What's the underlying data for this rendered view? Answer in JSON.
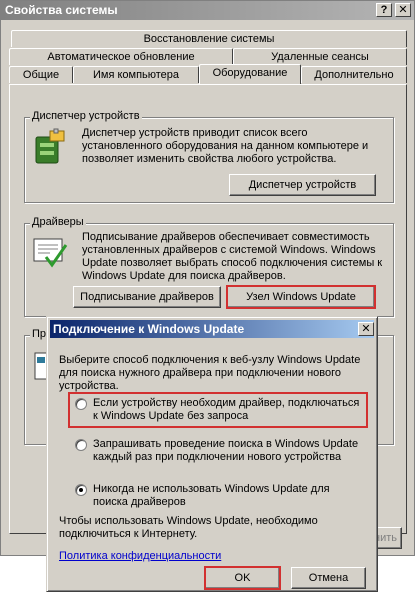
{
  "window": {
    "title": "Свойства системы",
    "help_glyph": "?",
    "close_glyph": "✕",
    "tabs_back": [
      "Восстановление системы"
    ],
    "tabs_middle": [
      "Автоматическое обновление",
      "Удаленные сеансы"
    ],
    "tabs_front": [
      "Общие",
      "Имя компьютера",
      "Оборудование",
      "Дополнительно"
    ],
    "active_tab": "Оборудование"
  },
  "device_manager": {
    "group_title": "Диспетчер устройств",
    "description": "Диспетчер устройств приводит список всего установленного оборудования на данном компьютере и позволяет изменить свойства любого устройства.",
    "button": "Диспетчер устройств"
  },
  "drivers": {
    "group_title": "Драйверы",
    "description": "Подписывание драйверов обеспечивает совместимость установленных драйверов с системой Windows.  Windows Update позволяет выбрать способ подключения системы к Windows Update для поиска драйверов.",
    "signing_button": "Подписывание драйверов",
    "windows_update_button": "Узел Windows Update"
  },
  "hidden_fragments": {
    "group_label_fragment": "Пр",
    "button_fragment": "нить"
  },
  "dialog": {
    "title": "Подключение к Windows Update",
    "close_glyph": "✕",
    "intro": "Выберите способ подключения к веб-узлу Windows Update для поиска нужного драйвера при подключении нового устройства.",
    "options": [
      {
        "label": "Если устройству необходим драйвер, подключаться к Windows Update без запроса",
        "selected": false
      },
      {
        "label": "Запрашивать проведение поиска в Windows Update каждый раз при подключении нового устройства",
        "selected": false
      },
      {
        "label": "Никогда не использовать Windows Update для поиска драйверов",
        "selected": true
      }
    ],
    "footer_note": "Чтобы использовать Windows Update, необходимо подключиться к Интернету.",
    "privacy_link": "Политика конфиденциальности",
    "ok_button": "OK",
    "cancel_button": "Отмена"
  },
  "colors": {
    "dialog_title_start": "#0a246a",
    "dialog_title_end": "#a6caf0",
    "inactive_title": "#808080",
    "highlight_outline": "#d23030",
    "face": "#d4d0c8"
  }
}
